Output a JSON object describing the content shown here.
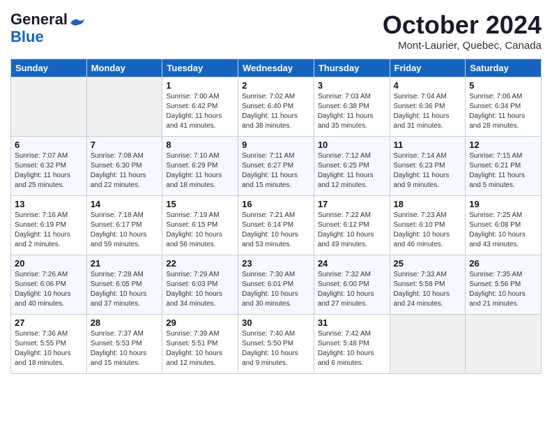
{
  "header": {
    "logo_line1": "General",
    "logo_line2": "Blue",
    "month": "October 2024",
    "location": "Mont-Laurier, Quebec, Canada"
  },
  "days_of_week": [
    "Sunday",
    "Monday",
    "Tuesday",
    "Wednesday",
    "Thursday",
    "Friday",
    "Saturday"
  ],
  "weeks": [
    [
      {
        "day": "",
        "info": ""
      },
      {
        "day": "",
        "info": ""
      },
      {
        "day": "1",
        "info": "Sunrise: 7:00 AM\nSunset: 6:42 PM\nDaylight: 11 hours and 41 minutes."
      },
      {
        "day": "2",
        "info": "Sunrise: 7:02 AM\nSunset: 6:40 PM\nDaylight: 11 hours and 38 minutes."
      },
      {
        "day": "3",
        "info": "Sunrise: 7:03 AM\nSunset: 6:38 PM\nDaylight: 11 hours and 35 minutes."
      },
      {
        "day": "4",
        "info": "Sunrise: 7:04 AM\nSunset: 6:36 PM\nDaylight: 11 hours and 31 minutes."
      },
      {
        "day": "5",
        "info": "Sunrise: 7:06 AM\nSunset: 6:34 PM\nDaylight: 11 hours and 28 minutes."
      }
    ],
    [
      {
        "day": "6",
        "info": "Sunrise: 7:07 AM\nSunset: 6:32 PM\nDaylight: 11 hours and 25 minutes."
      },
      {
        "day": "7",
        "info": "Sunrise: 7:08 AM\nSunset: 6:30 PM\nDaylight: 11 hours and 22 minutes."
      },
      {
        "day": "8",
        "info": "Sunrise: 7:10 AM\nSunset: 6:29 PM\nDaylight: 11 hours and 18 minutes."
      },
      {
        "day": "9",
        "info": "Sunrise: 7:11 AM\nSunset: 6:27 PM\nDaylight: 11 hours and 15 minutes."
      },
      {
        "day": "10",
        "info": "Sunrise: 7:12 AM\nSunset: 6:25 PM\nDaylight: 11 hours and 12 minutes."
      },
      {
        "day": "11",
        "info": "Sunrise: 7:14 AM\nSunset: 6:23 PM\nDaylight: 11 hours and 9 minutes."
      },
      {
        "day": "12",
        "info": "Sunrise: 7:15 AM\nSunset: 6:21 PM\nDaylight: 11 hours and 5 minutes."
      }
    ],
    [
      {
        "day": "13",
        "info": "Sunrise: 7:16 AM\nSunset: 6:19 PM\nDaylight: 11 hours and 2 minutes."
      },
      {
        "day": "14",
        "info": "Sunrise: 7:18 AM\nSunset: 6:17 PM\nDaylight: 10 hours and 59 minutes."
      },
      {
        "day": "15",
        "info": "Sunrise: 7:19 AM\nSunset: 6:15 PM\nDaylight: 10 hours and 56 minutes."
      },
      {
        "day": "16",
        "info": "Sunrise: 7:21 AM\nSunset: 6:14 PM\nDaylight: 10 hours and 53 minutes."
      },
      {
        "day": "17",
        "info": "Sunrise: 7:22 AM\nSunset: 6:12 PM\nDaylight: 10 hours and 49 minutes."
      },
      {
        "day": "18",
        "info": "Sunrise: 7:23 AM\nSunset: 6:10 PM\nDaylight: 10 hours and 46 minutes."
      },
      {
        "day": "19",
        "info": "Sunrise: 7:25 AM\nSunset: 6:08 PM\nDaylight: 10 hours and 43 minutes."
      }
    ],
    [
      {
        "day": "20",
        "info": "Sunrise: 7:26 AM\nSunset: 6:06 PM\nDaylight: 10 hours and 40 minutes."
      },
      {
        "day": "21",
        "info": "Sunrise: 7:28 AM\nSunset: 6:05 PM\nDaylight: 10 hours and 37 minutes."
      },
      {
        "day": "22",
        "info": "Sunrise: 7:29 AM\nSunset: 6:03 PM\nDaylight: 10 hours and 34 minutes."
      },
      {
        "day": "23",
        "info": "Sunrise: 7:30 AM\nSunset: 6:01 PM\nDaylight: 10 hours and 30 minutes."
      },
      {
        "day": "24",
        "info": "Sunrise: 7:32 AM\nSunset: 6:00 PM\nDaylight: 10 hours and 27 minutes."
      },
      {
        "day": "25",
        "info": "Sunrise: 7:33 AM\nSunset: 5:58 PM\nDaylight: 10 hours and 24 minutes."
      },
      {
        "day": "26",
        "info": "Sunrise: 7:35 AM\nSunset: 5:56 PM\nDaylight: 10 hours and 21 minutes."
      }
    ],
    [
      {
        "day": "27",
        "info": "Sunrise: 7:36 AM\nSunset: 5:55 PM\nDaylight: 10 hours and 18 minutes."
      },
      {
        "day": "28",
        "info": "Sunrise: 7:37 AM\nSunset: 5:53 PM\nDaylight: 10 hours and 15 minutes."
      },
      {
        "day": "29",
        "info": "Sunrise: 7:39 AM\nSunset: 5:51 PM\nDaylight: 10 hours and 12 minutes."
      },
      {
        "day": "30",
        "info": "Sunrise: 7:40 AM\nSunset: 5:50 PM\nDaylight: 10 hours and 9 minutes."
      },
      {
        "day": "31",
        "info": "Sunrise: 7:42 AM\nSunset: 5:48 PM\nDaylight: 10 hours and 6 minutes."
      },
      {
        "day": "",
        "info": ""
      },
      {
        "day": "",
        "info": ""
      }
    ]
  ]
}
